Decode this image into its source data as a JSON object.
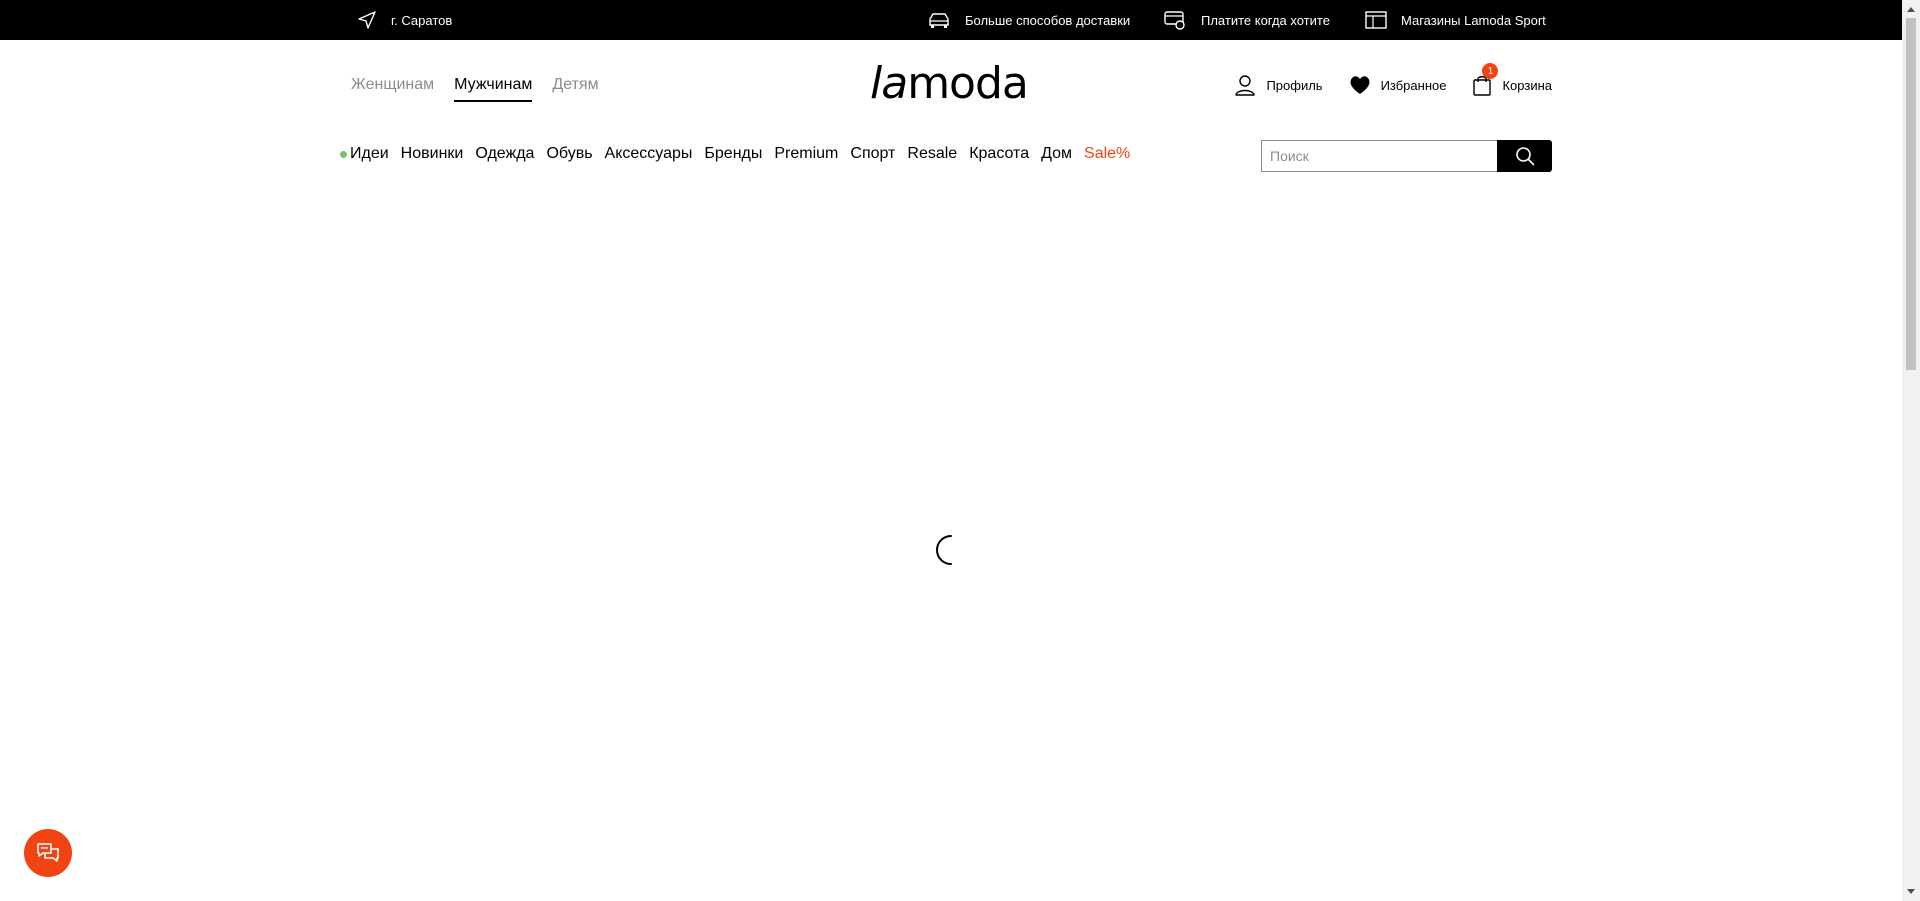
{
  "topbar": {
    "city": "г. Саратов",
    "delivery": "Больше способов доставки",
    "pay": "Платите когда хотите",
    "stores": "Магазины Lamoda Sport"
  },
  "gender_tabs": [
    "Женщинам",
    "Мужчинам",
    "Детям"
  ],
  "active_gender": "Мужчинам",
  "logo": {
    "part1": "la",
    "part2": "moda"
  },
  "actions": {
    "profile": "Профиль",
    "favorites": "Избранное",
    "cart": "Корзина",
    "cart_count": "1"
  },
  "categories": [
    "Идеи",
    "Новинки",
    "Одежда",
    "Обувь",
    "Аксессуары",
    "Бренды",
    "Premium",
    "Спорт",
    "Resale",
    "Красота",
    "Дом",
    "Sale%"
  ],
  "search": {
    "placeholder": "Поиск"
  },
  "colors": {
    "accent": "#f14412",
    "ideas_dot": "#7fc26a"
  },
  "icons": {
    "city": "navigation-arrow-icon",
    "delivery": "car-icon",
    "pay": "payment-icon",
    "stores": "store-icon",
    "profile": "user-icon",
    "favorites": "heart-icon",
    "cart": "bag-icon",
    "search": "search-icon",
    "chat": "chat-icon",
    "loading": "spinner-icon"
  }
}
